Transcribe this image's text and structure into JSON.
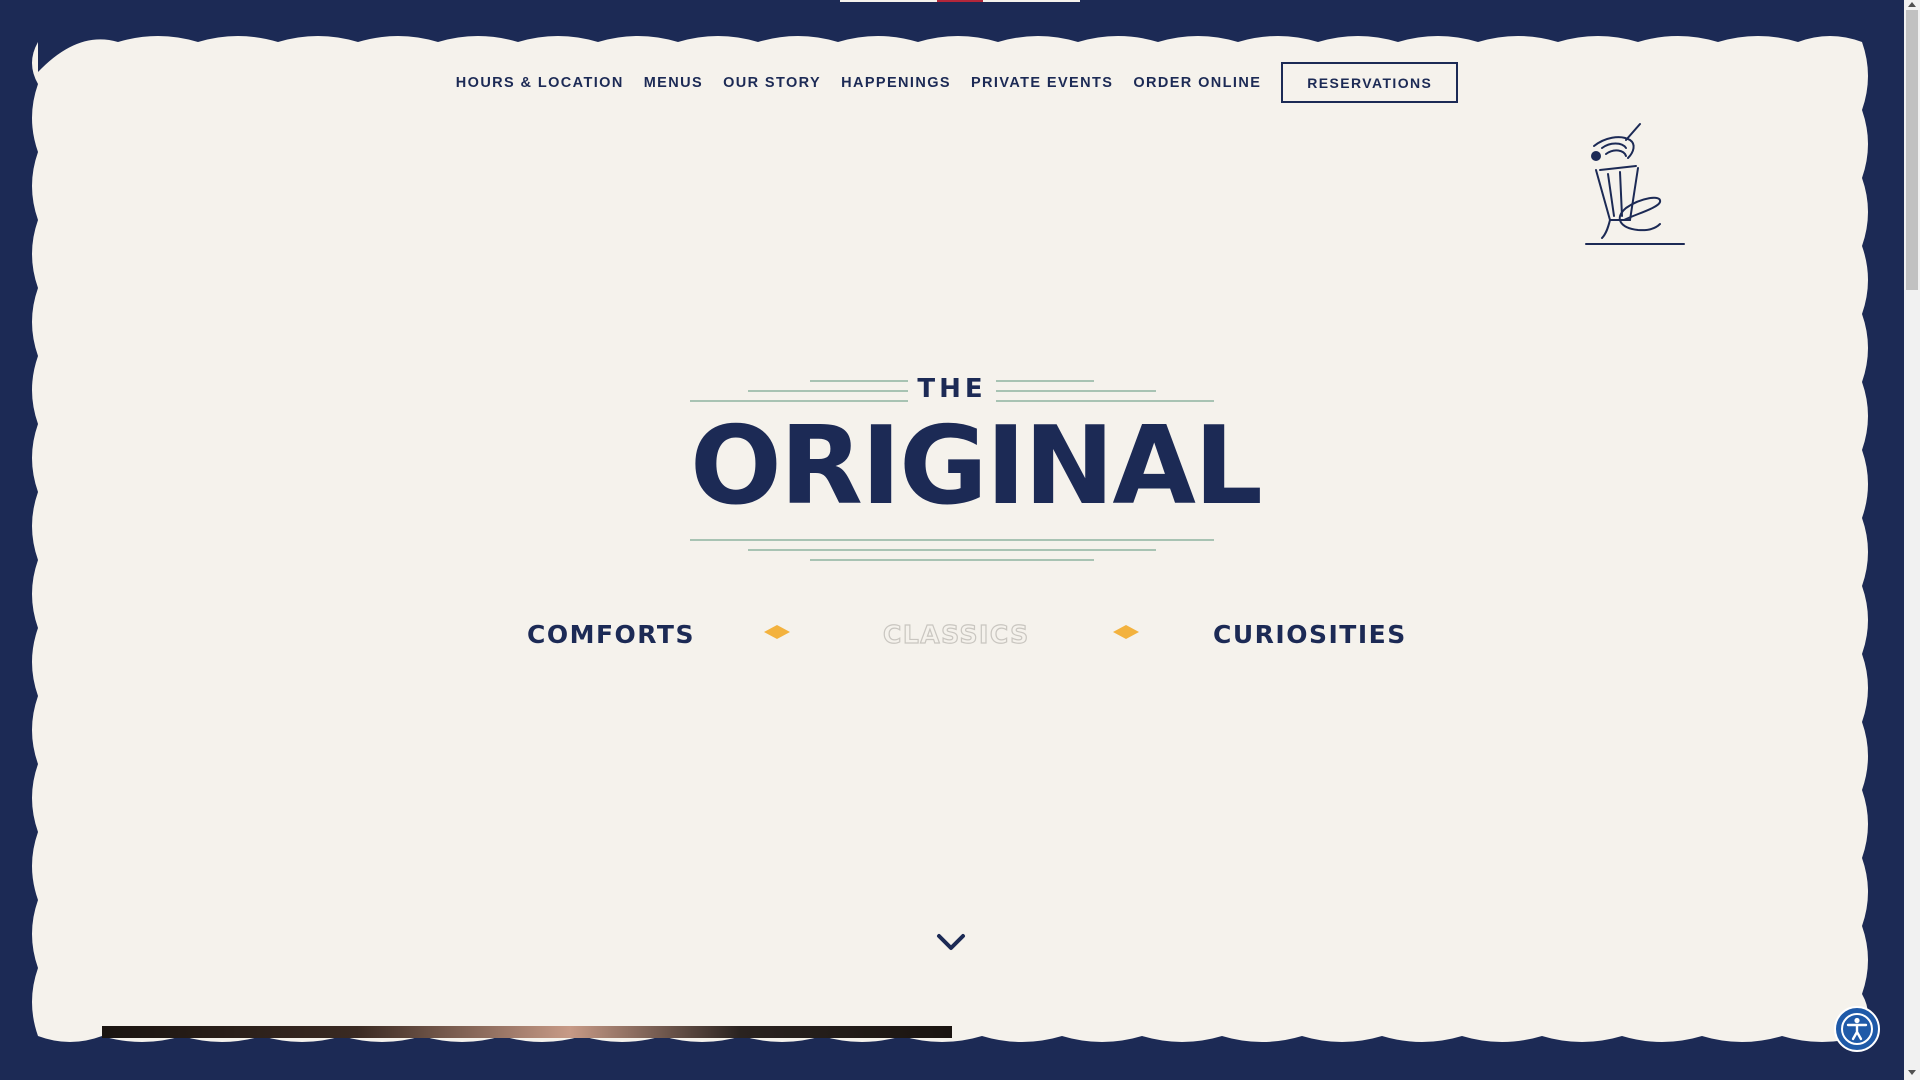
{
  "colors": {
    "background": "#1c2a55",
    "cream": "#f5f2ec",
    "navy": "#1c2a55",
    "sage": "#8fb3a0",
    "accent_gold": "#f3b23e",
    "indicator_red": "#b3263a",
    "a11y_blue": "#1f5aa8"
  },
  "nav": {
    "items": [
      {
        "label": "HOURS & LOCATION"
      },
      {
        "label": "MENUS"
      },
      {
        "label": "OUR STORY"
      },
      {
        "label": "HAPPENINGS"
      },
      {
        "label": "PRIVATE EVENTS"
      },
      {
        "label": "ORDER ONLINE"
      }
    ],
    "reservations_label": "RESERVATIONS"
  },
  "logo": {
    "the": "THE",
    "original": "ORIGINAL"
  },
  "categories": [
    {
      "label": "COMFORTS",
      "active": true
    },
    {
      "label": "CLASSICS",
      "active": false
    },
    {
      "label": "CURIOSITIES",
      "active": true
    }
  ],
  "icons": {
    "mascot": "milkshake-mascot-icon",
    "separator": "diamond-icon",
    "scroll_down": "chevron-down-icon",
    "accessibility": "accessibility-icon"
  }
}
